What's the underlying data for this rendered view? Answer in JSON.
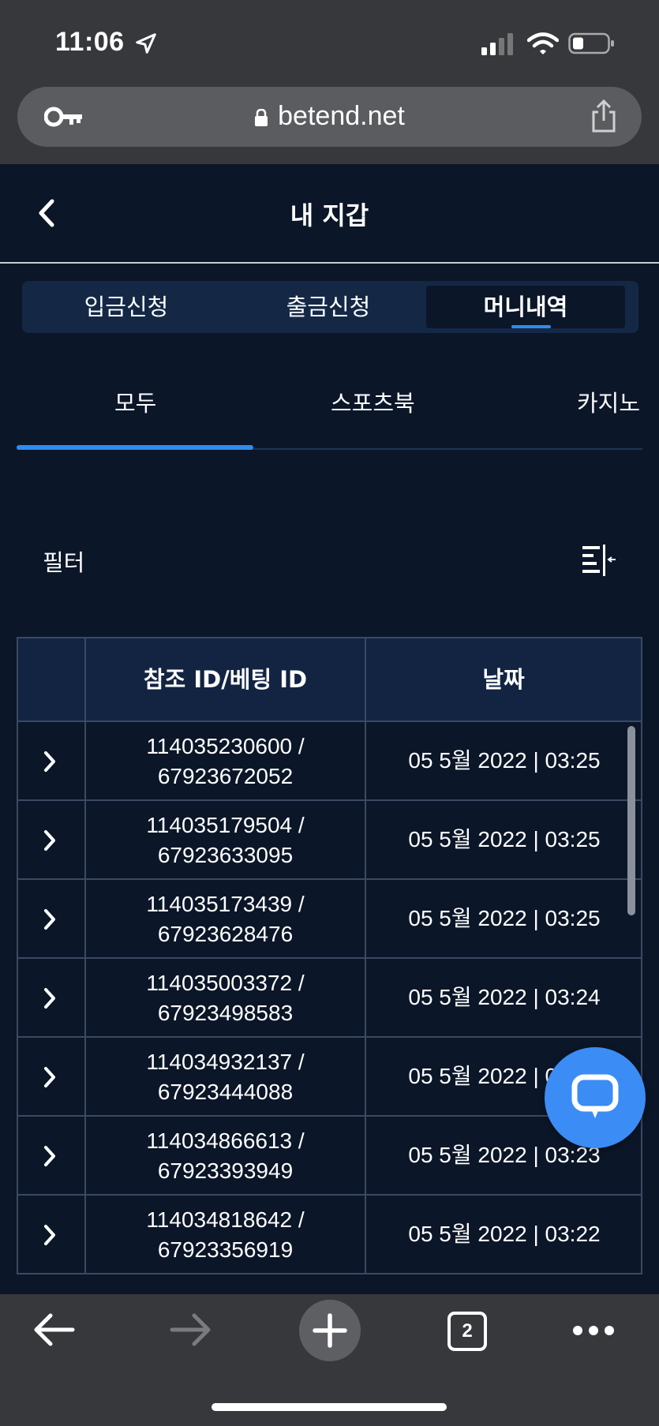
{
  "status_bar": {
    "time": "11:06",
    "icons": [
      "location-icon",
      "cellular-signal-icon",
      "wifi-icon",
      "battery-icon"
    ]
  },
  "browser": {
    "url": "betend.net",
    "tab_count": "2",
    "icons": [
      "key-icon",
      "lock-icon",
      "share-icon",
      "back-arrow-icon",
      "forward-arrow-icon",
      "plus-icon",
      "tabs-icon",
      "more-icon"
    ]
  },
  "header": {
    "title": "내 지갑",
    "back_icon": "chevron-left-icon"
  },
  "segment_tabs": [
    {
      "label": "입금신청",
      "active": false
    },
    {
      "label": "출금신청",
      "active": false
    },
    {
      "label": "머니내역",
      "active": true
    }
  ],
  "category_tabs": [
    {
      "label": "모두",
      "active": true
    },
    {
      "label": "스포츠북",
      "active": false
    },
    {
      "label": "카지노",
      "active": false
    }
  ],
  "filter": {
    "label": "필터",
    "icon": "filter-panel-icon"
  },
  "table": {
    "headers": [
      "",
      "참조 ID/베팅 ID",
      "날짜"
    ],
    "rows": [
      {
        "ref_id": "114035230600 /",
        "bet_id": "67923672052",
        "date": "05 5월 2022 | 03:25"
      },
      {
        "ref_id": "114035179504 /",
        "bet_id": "67923633095",
        "date": "05 5월 2022 | 03:25"
      },
      {
        "ref_id": "114035173439 /",
        "bet_id": "67923628476",
        "date": "05 5월 2022 | 03:25"
      },
      {
        "ref_id": "114035003372 /",
        "bet_id": "67923498583",
        "date": "05 5월 2022 | 03:24"
      },
      {
        "ref_id": "114034932137 /",
        "bet_id": "67923444088",
        "date": "05 5월 2022 | 03:24"
      },
      {
        "ref_id": "114034866613 /",
        "bet_id": "67923393949",
        "date": "05 5월 2022 | 03:23"
      },
      {
        "ref_id": "114034818642 /",
        "bet_id": "67923356919",
        "date": "05 5월 2022 | 03:22"
      }
    ]
  },
  "chat_button": {
    "icon": "chat-bubble-icon"
  },
  "colors": {
    "background": "#0b1628",
    "accent": "#2e8cf0",
    "chat_button": "#3b8cf5",
    "table_header": "#122442",
    "browser_chrome": "#37383c"
  }
}
